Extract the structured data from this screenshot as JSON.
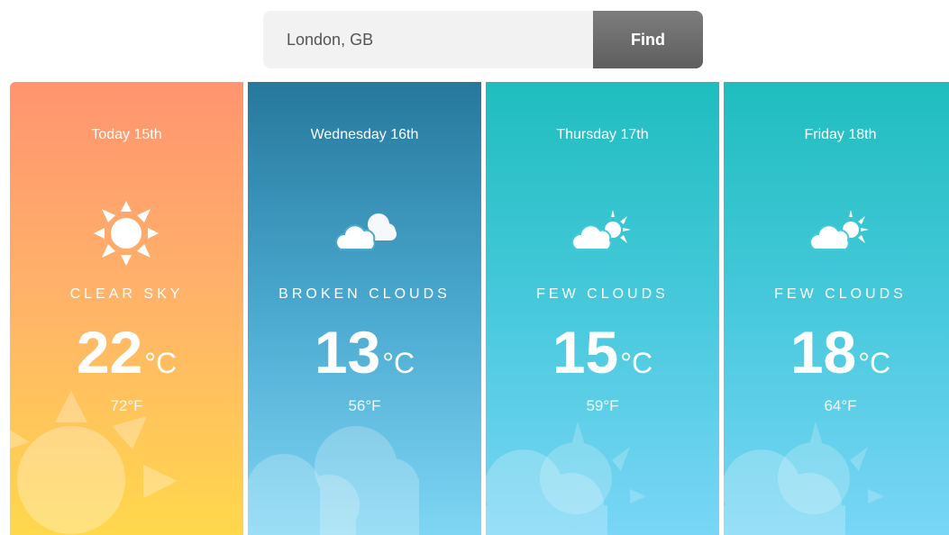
{
  "search": {
    "value": "London, GB",
    "button_label": "Find"
  },
  "forecast": [
    {
      "date": "Today 15th",
      "description": "CLEAR SKY",
      "temp_c": "22",
      "unit_c": "°C",
      "temp_f": "72°F",
      "icon": "sun-icon",
      "gradient": [
        "#ff946f",
        "#ffd84c"
      ]
    },
    {
      "date": "Wednesday 16th",
      "description": "BROKEN CLOUDS",
      "temp_c": "13",
      "unit_c": "°C",
      "temp_f": "56°F",
      "icon": "broken-clouds-icon",
      "gradient": [
        "#26789c",
        "#7fd6f4"
      ]
    },
    {
      "date": "Thursday 17th",
      "description": "FEW CLOUDS",
      "temp_c": "15",
      "unit_c": "°C",
      "temp_f": "59°F",
      "icon": "few-clouds-icon",
      "gradient": [
        "#1fbdbe",
        "#7ad6f6"
      ]
    },
    {
      "date": "Friday 18th",
      "description": "FEW CLOUDS",
      "temp_c": "18",
      "unit_c": "°C",
      "temp_f": "64°F",
      "icon": "few-clouds-icon",
      "gradient": [
        "#1fbdbe",
        "#7ad6f6"
      ]
    }
  ]
}
